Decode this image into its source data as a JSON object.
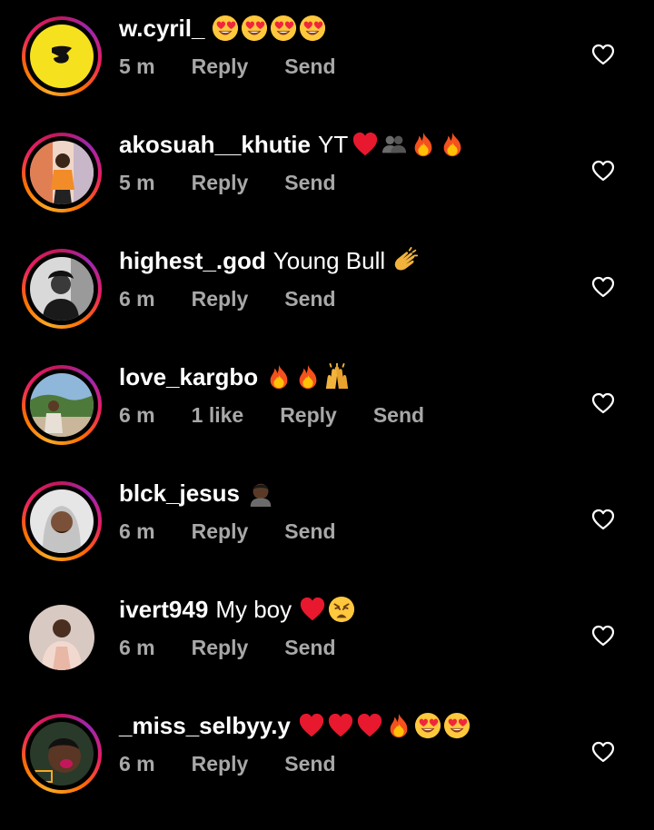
{
  "comments": [
    {
      "username": "w.cyril_",
      "text": "",
      "emojis": [
        "heart-eyes-emoji",
        "heart-eyes-emoji",
        "heart-eyes-emoji",
        "heart-eyes-emoji"
      ],
      "time": "5 m",
      "likes": "",
      "reply_label": "Reply",
      "send_label": "Send"
    },
    {
      "username": "akosuah__khutie",
      "text": "YT",
      "emojis": [
        "red-heart-emoji",
        "busts-emoji",
        "fire-emoji",
        "fire-emoji"
      ],
      "time": "5 m",
      "likes": "",
      "reply_label": "Reply",
      "send_label": "Send"
    },
    {
      "username": "highest_.god",
      "text": "Young Bull",
      "emojis": [
        "clapping-hands-emoji"
      ],
      "time": "6 m",
      "likes": "",
      "reply_label": "Reply",
      "send_label": "Send"
    },
    {
      "username": "love_kargbo",
      "text": "",
      "emojis": [
        "fire-emoji",
        "fire-emoji",
        "raising-hands-emoji"
      ],
      "time": "6 m",
      "likes": "1 like",
      "reply_label": "Reply",
      "send_label": "Send"
    },
    {
      "username": "blck_jesus",
      "text": "",
      "emojis": [
        "man-dark-skin-emoji"
      ],
      "time": "6 m",
      "likes": "",
      "reply_label": "Reply",
      "send_label": "Send"
    },
    {
      "username": "ivert949",
      "text": "My boy",
      "emojis": [
        "red-heart-emoji",
        "weary-face-emoji"
      ],
      "time": "6 m",
      "likes": "",
      "reply_label": "Reply",
      "send_label": "Send"
    },
    {
      "username": "_miss_selbyy.y",
      "text": "",
      "emojis": [
        "red-heart-emoji",
        "red-heart-emoji",
        "red-heart-emoji",
        "fire-emoji",
        "heart-eyes-emoji",
        "heart-eyes-emoji"
      ],
      "time": "6 m",
      "likes": "",
      "reply_label": "Reply",
      "send_label": "Send"
    }
  ],
  "colors": {
    "background": "#000000",
    "meta_text": "#a8a8a8",
    "story_ring": "#e91e63"
  }
}
